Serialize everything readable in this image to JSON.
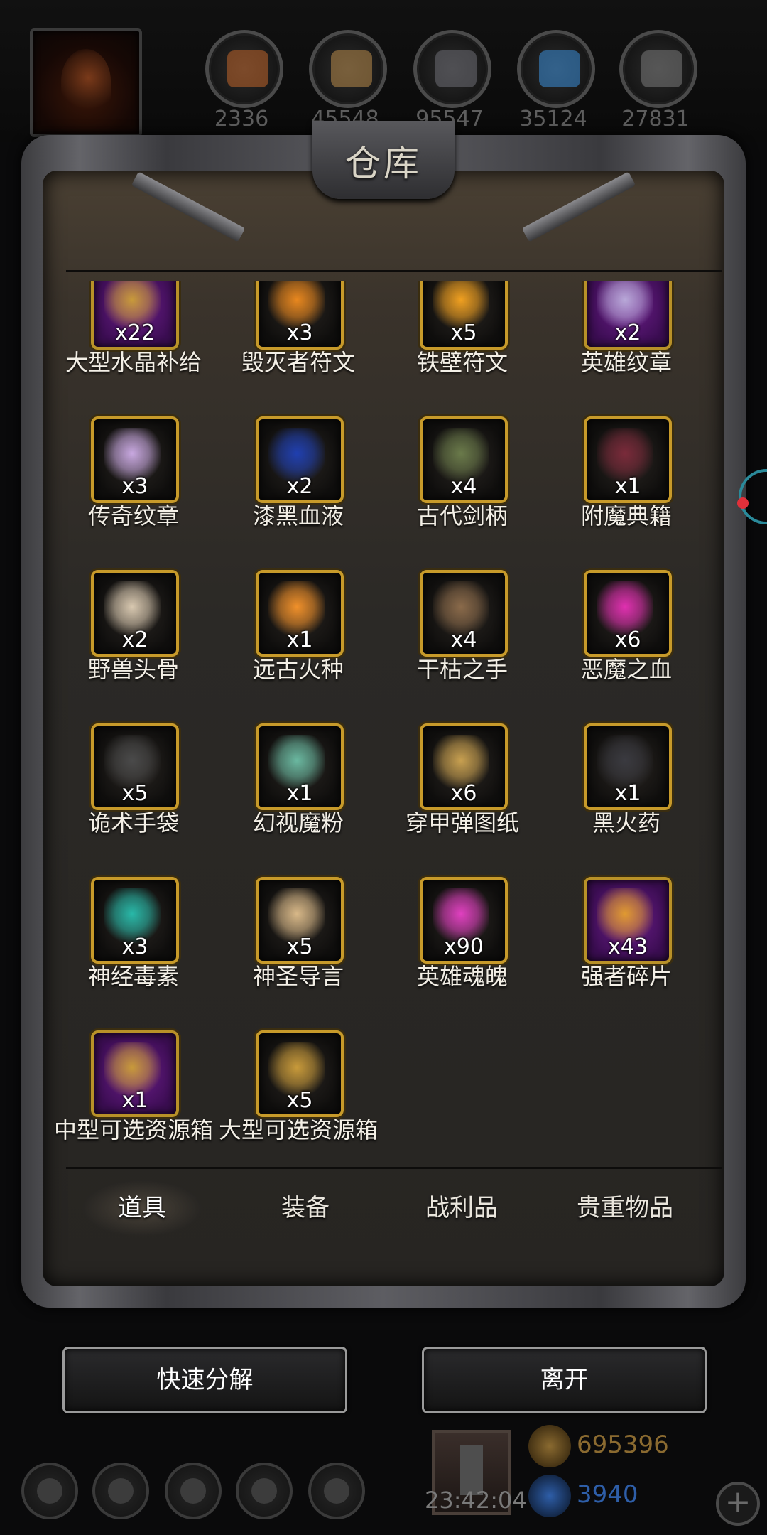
{
  "topbar": {
    "resources": [
      {
        "icon": "meat-icon",
        "value": "2336",
        "color": "#c0642a"
      },
      {
        "icon": "wood-icon",
        "value": "45548",
        "color": "#b88a4a"
      },
      {
        "icon": "iron-icon",
        "value": "95547",
        "color": "#6e6e74"
      },
      {
        "icon": "crystal-icon",
        "value": "35124",
        "color": "#3b8ed8"
      },
      {
        "icon": "stone-icon",
        "value": "27831",
        "color": "#7a7a7a"
      }
    ]
  },
  "warehouse": {
    "title": "仓库",
    "items": [
      {
        "name": "大型水晶补给",
        "qty": "x22",
        "frame": "purple",
        "icon": "chest-icon",
        "color": "#c89a3a"
      },
      {
        "name": "毁灭者符文",
        "qty": "x3",
        "frame": "gold",
        "icon": "rune-icon",
        "color": "#e8871e"
      },
      {
        "name": "铁壁符文",
        "qty": "x5",
        "frame": "gold",
        "icon": "rune-icon",
        "color": "#f0a020"
      },
      {
        "name": "英雄纹章",
        "qty": "x2",
        "frame": "purple",
        "icon": "crest-icon",
        "color": "#b8a8d8"
      },
      {
        "name": "传奇纹章",
        "qty": "x3",
        "frame": "gold",
        "icon": "crest-icon",
        "color": "#c8a8e0"
      },
      {
        "name": "漆黑血液",
        "qty": "x2",
        "frame": "gold",
        "icon": "black-drop-icon",
        "color": "#1f3fb0"
      },
      {
        "name": "古代剑柄",
        "qty": "x4",
        "frame": "gold",
        "icon": "sword-hilt-icon",
        "color": "#6a7a4a"
      },
      {
        "name": "附魔典籍",
        "qty": "x1",
        "frame": "gold",
        "icon": "book-icon",
        "color": "#7a2a3a"
      },
      {
        "name": "野兽头骨",
        "qty": "x2",
        "frame": "gold",
        "icon": "skull-icon",
        "color": "#d8c8b0"
      },
      {
        "name": "远古火种",
        "qty": "x1",
        "frame": "gold",
        "icon": "fire-seed-icon",
        "color": "#f0902a"
      },
      {
        "name": "干枯之手",
        "qty": "x4",
        "frame": "gold",
        "icon": "hand-icon",
        "color": "#8a6a4a"
      },
      {
        "name": "恶魔之血",
        "qty": "x6",
        "frame": "gold",
        "icon": "demon-blood-icon",
        "color": "#e030b0"
      },
      {
        "name": "诡术手袋",
        "qty": "x5",
        "frame": "gold",
        "icon": "pouch-icon",
        "color": "#4a4a4a"
      },
      {
        "name": "幻视魔粉",
        "qty": "x1",
        "frame": "gold",
        "icon": "powder-icon",
        "color": "#6ab8a0"
      },
      {
        "name": "穿甲弹图纸",
        "qty": "x6",
        "frame": "gold",
        "icon": "scroll-icon",
        "color": "#c8a050"
      },
      {
        "name": "黑火药",
        "qty": "x1",
        "frame": "gold",
        "icon": "gunpowder-icon",
        "color": "#3a3a40"
      },
      {
        "name": "神经毒素",
        "qty": "x3",
        "frame": "gold",
        "icon": "toxin-icon",
        "color": "#28b8a8"
      },
      {
        "name": "神圣导言",
        "qty": "x5",
        "frame": "gold",
        "icon": "parchment-icon",
        "color": "#d8b888"
      },
      {
        "name": "英雄魂魄",
        "qty": "x90",
        "frame": "gold",
        "icon": "soul-icon",
        "color": "#e040c0"
      },
      {
        "name": "强者碎片",
        "qty": "x43",
        "frame": "purple",
        "icon": "shard-icon",
        "color": "#e09a30"
      },
      {
        "name": "中型可选资源箱",
        "qty": "x1",
        "frame": "purple",
        "icon": "chest-icon",
        "color": "#c89a3a"
      },
      {
        "name": "大型可选资源箱",
        "qty": "x5",
        "frame": "gold",
        "icon": "chest-icon",
        "color": "#c89a3a"
      }
    ],
    "tabs": [
      "道具",
      "装备",
      "战利品",
      "贵重物品"
    ],
    "active_tab": "道具"
  },
  "actions": {
    "quick_decompose": "快速分解",
    "leave": "离开"
  },
  "bottombar": {
    "time": "23:42:04",
    "gold": "695396",
    "gems": "3940",
    "gold_color": "#8a6a30",
    "gem_color": "#2e5ea8",
    "plus": "+"
  }
}
